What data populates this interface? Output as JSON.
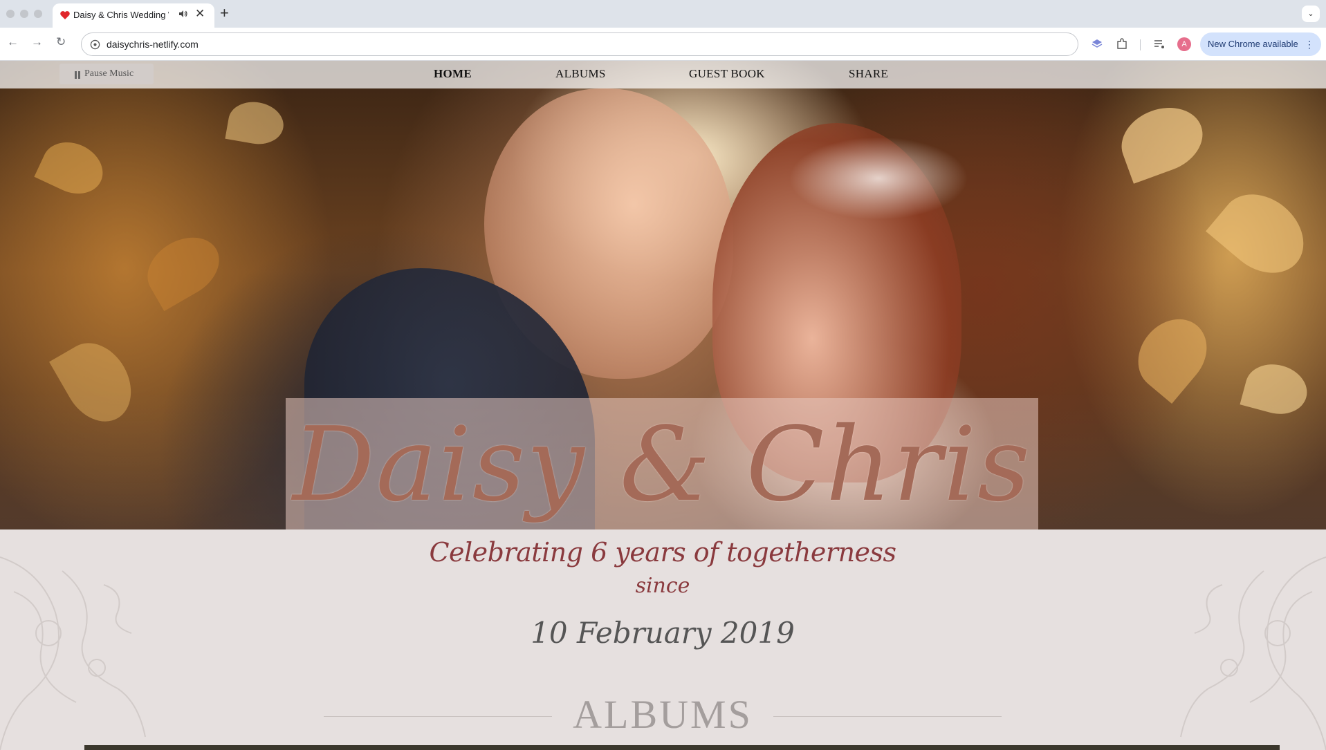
{
  "browser": {
    "tab": {
      "title": "Daisy & Chris Wedding W",
      "favicon": "heart-icon",
      "audio_icon": "speaker-icon",
      "close_glyph": "✕"
    },
    "new_tab_glyph": "+",
    "tab_menu_glyph": "⌄",
    "url": "daisychris-netlify.com",
    "back_glyph": "←",
    "forward_glyph": "→",
    "reload_glyph": "↻",
    "profile_initial": "A",
    "update_label": "New Chrome available",
    "update_menu_glyph": "⋮",
    "icons": [
      "site-info-icon",
      "extension-icon",
      "puzzle-icon",
      "media-icon"
    ]
  },
  "nav": {
    "pause_label": "Pause Music",
    "items": [
      {
        "label": "HOME",
        "active": true
      },
      {
        "label": "ALBUMS",
        "active": false
      },
      {
        "label": "GUEST BOOK",
        "active": false
      },
      {
        "label": "SHARE",
        "active": false
      }
    ]
  },
  "hero": {
    "names": "Daisy & Chris",
    "tagline": "Celebrating 6 years of togetherness",
    "since": "since",
    "date": "10 February 2019"
  },
  "albums": {
    "heading": "ALBUMS"
  },
  "colors": {
    "accent_name": "#a46a58",
    "accent_tagline": "#8a3a3e",
    "heading_muted": "#a49e9d",
    "page_bg": "#e6e0df"
  }
}
